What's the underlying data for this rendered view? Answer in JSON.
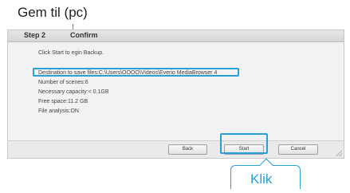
{
  "annotations": {
    "top_label": "Gem til (pc)",
    "bottom_label": "Klik"
  },
  "dialog": {
    "step_label": "Step 2",
    "title": "Confirm",
    "intro_text": "Click Start to  egin Backup.",
    "destination_text": "Destination to save files:C:\\Users\\OOOO\\Videos\\Everio MediaBrowser 4",
    "scenes_text": "Number of scenes:6",
    "capacity_text": "Necessary capacity:< 0.1GB",
    "free_space_text": "Free space:11.2 GB",
    "file_analysis_text": "File analysis:ON"
  },
  "buttons": {
    "back": "Back",
    "start": "Start",
    "cancel": "Cancel"
  },
  "colors": {
    "annotation_accent": "#2a9fd6"
  }
}
